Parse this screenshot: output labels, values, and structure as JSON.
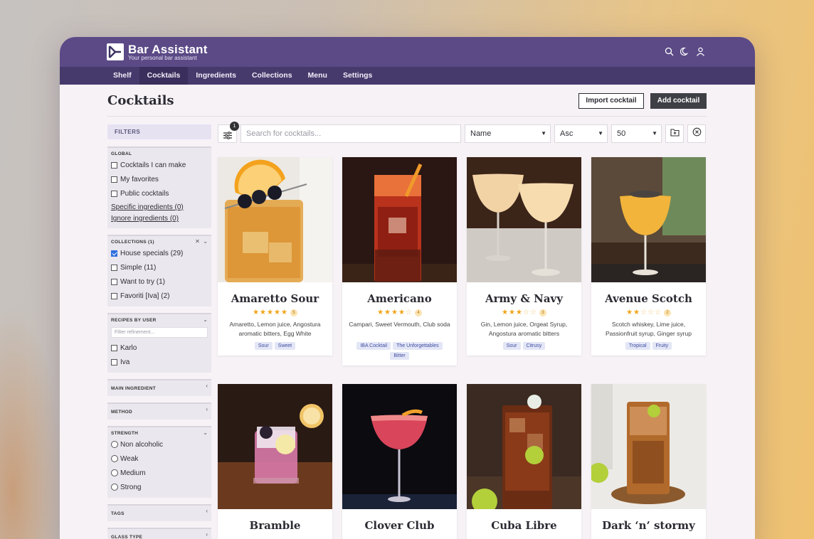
{
  "app": {
    "title": "Bar Assistant",
    "subtitle": "Your personal bar assistant"
  },
  "nav": [
    "Shelf",
    "Cocktails",
    "Ingredients",
    "Collections",
    "Menu",
    "Settings"
  ],
  "nav_active": "Cocktails",
  "page": {
    "title": "Cocktails",
    "import_label": "Import cocktail",
    "add_label": "Add cocktail"
  },
  "toolbar": {
    "filter_badge": "1",
    "search_placeholder": "Search for cocktails...",
    "sort_field": "Name",
    "sort_dir": "Asc",
    "per_page": "50"
  },
  "sidebar": {
    "filters_title": "FILTERS",
    "global": {
      "title": "GLOBAL",
      "options": [
        "Cocktails I can make",
        "My favorites",
        "Public cocktails"
      ],
      "links": [
        "Specific ingredients (0)",
        "Ignore ingredients (0)"
      ]
    },
    "collections": {
      "title": "COLLECTIONS (1)",
      "options": [
        {
          "label": "House specials (29)",
          "checked": true
        },
        {
          "label": "Simple (11)",
          "checked": false
        },
        {
          "label": "Want to try (1)",
          "checked": false
        },
        {
          "label": "Favoriti [Iva] (2)",
          "checked": false
        }
      ]
    },
    "recipes_by_user": {
      "title": "RECIPES BY USER",
      "placeholder": "Filter refinement...",
      "options": [
        "Karlo",
        "Iva"
      ]
    },
    "main_ingredient": {
      "title": "MAIN INGREDIENT"
    },
    "method": {
      "title": "METHOD"
    },
    "strength": {
      "title": "STRENGTH",
      "options": [
        "Non alcoholic",
        "Weak",
        "Medium",
        "Strong"
      ]
    },
    "tags": {
      "title": "TAGS"
    },
    "glass_type": {
      "title": "GLASS TYPE"
    }
  },
  "cocktails": [
    {
      "name": "Amaretto Sour",
      "rating": 5,
      "rating_label": "5",
      "ingredients": "Amaretto, Lemon juice, Angostura aromatic bitters, Egg White",
      "tags": [
        "Sour",
        "Sweet"
      ]
    },
    {
      "name": "Americano",
      "rating": 4,
      "rating_label": "4",
      "ingredients": "Campari, Sweet Vermouth, Club soda",
      "tags": [
        "IBA Cocktail",
        "The Unforgettables",
        "Bitter"
      ]
    },
    {
      "name": "Army & Navy",
      "rating": 3,
      "rating_label": "3",
      "ingredients": "Gin, Lemon juice, Orgeat Syrup, Angostura aromatic bitters",
      "tags": [
        "Sour",
        "Citrusy"
      ]
    },
    {
      "name": "Avenue Scotch",
      "rating": 2,
      "rating_label": "2",
      "ingredients": "Scotch whiskey, Lime juice, Passionfruit syrup, Ginger syrup",
      "tags": [
        "Tropical",
        "Fruity"
      ]
    },
    {
      "name": "Bramble"
    },
    {
      "name": "Clover Club"
    },
    {
      "name": "Cuba Libre"
    },
    {
      "name": "Dark ‘n’ stormy"
    }
  ],
  "colors": {
    "header": "#5b4a86",
    "nav": "#463a6c",
    "accent_star": "#f0a418",
    "tag_bg": "#e3e6f6",
    "tag_text": "#3f4ea0"
  },
  "icons": [
    "search-icon",
    "moon-icon",
    "user-icon",
    "filter-sliders-icon",
    "folder-add-icon",
    "clear-circle-icon",
    "chevron-down-icon",
    "chevron-left-icon",
    "close-icon"
  ]
}
